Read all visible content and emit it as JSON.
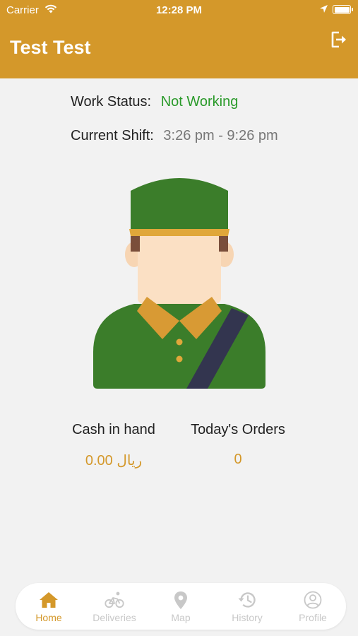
{
  "status_bar": {
    "carrier": "Carrier",
    "time": "12:28 PM"
  },
  "header": {
    "title": "Test Test",
    "logout_icon": "logout-icon"
  },
  "work_status": {
    "label": "Work Status:",
    "value": "Not Working",
    "value_color": "#2a9a2a"
  },
  "current_shift": {
    "label": "Current Shift:",
    "value": "3:26 pm - 9:26 pm"
  },
  "stats": {
    "cash_label": "Cash in hand",
    "cash_value": "0.00 ريال",
    "orders_label": "Today's Orders",
    "orders_value": "0"
  },
  "tabs": [
    {
      "label": "Home",
      "icon": "home-icon",
      "active": true
    },
    {
      "label": "Deliveries",
      "icon": "bicycle-icon",
      "active": false
    },
    {
      "label": "Map",
      "icon": "map-pin-icon",
      "active": false
    },
    {
      "label": "History",
      "icon": "history-icon",
      "active": false
    },
    {
      "label": "Profile",
      "icon": "profile-icon",
      "active": false
    }
  ],
  "colors": {
    "accent": "#d4982a",
    "background": "#f2f2f2",
    "inactive_tab": "#c8c8c8"
  }
}
